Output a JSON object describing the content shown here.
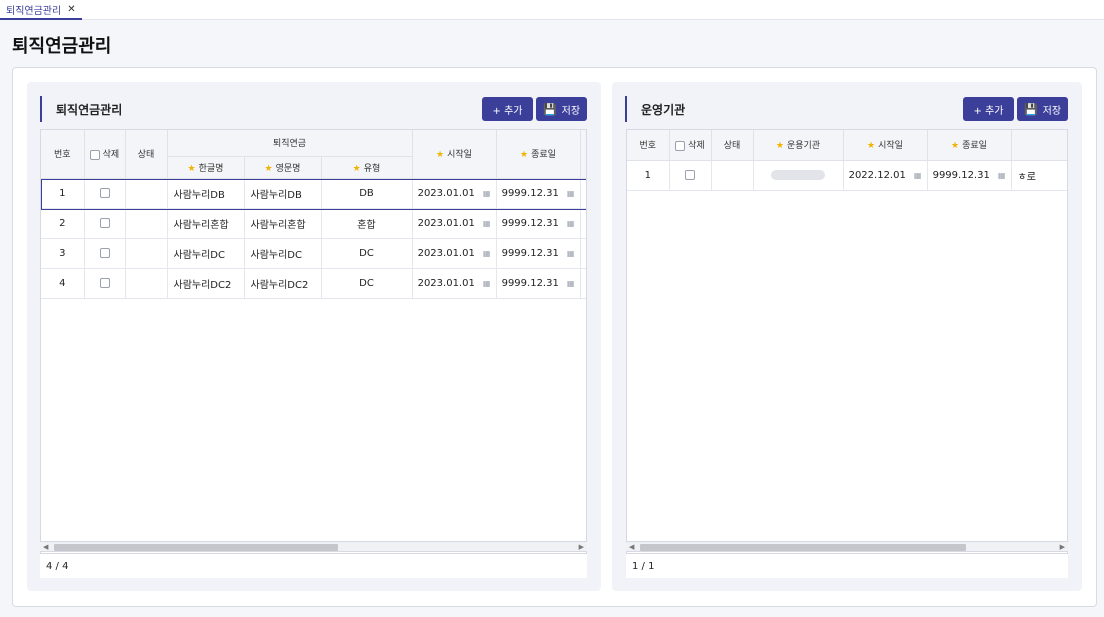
{
  "tab": {
    "label": "퇴직연금관리",
    "close": "✕"
  },
  "page_title": "퇴직연금관리",
  "left": {
    "title": "퇴직연금관리",
    "add_label": "+ 추가",
    "save_label": "저장",
    "headers": {
      "no": "번호",
      "delete": "삭제",
      "status": "상태",
      "group": "퇴직연금",
      "korean_name": "한글명",
      "english_name": "영문명",
      "type": "유형",
      "start_date": "시작일",
      "end_date": "종료일"
    },
    "rows": [
      {
        "no": "1",
        "kor": "사람누리DB",
        "eng": "사람누리DB",
        "type": "DB",
        "start": "2023.01.01",
        "end": "9999.12.31"
      },
      {
        "no": "2",
        "kor": "사람누리혼합",
        "eng": "사람누리혼합",
        "type": "혼합",
        "start": "2023.01.01",
        "end": "9999.12.31"
      },
      {
        "no": "3",
        "kor": "사람누리DC",
        "eng": "사람누리DC",
        "type": "DC",
        "start": "2023.01.01",
        "end": "9999.12.31"
      },
      {
        "no": "4",
        "kor": "사람누리DC2",
        "eng": "사람누리DC2",
        "type": "DC",
        "start": "2023.01.01",
        "end": "9999.12.31"
      }
    ],
    "count": "4 / 4"
  },
  "right": {
    "title": "운영기관",
    "add_label": "+ 추가",
    "save_label": "저장",
    "headers": {
      "no": "번호",
      "delete": "삭제",
      "status": "상태",
      "org": "운용기관",
      "start_date": "시작일",
      "end_date": "종료일"
    },
    "rows": [
      {
        "no": "1",
        "start": "2022.12.01",
        "end": "9999.12.31",
        "extra": "ㅎ로"
      }
    ],
    "count": "1 / 1"
  },
  "colors": {
    "accent": "#3b3f9a",
    "star": "#f0b400"
  }
}
